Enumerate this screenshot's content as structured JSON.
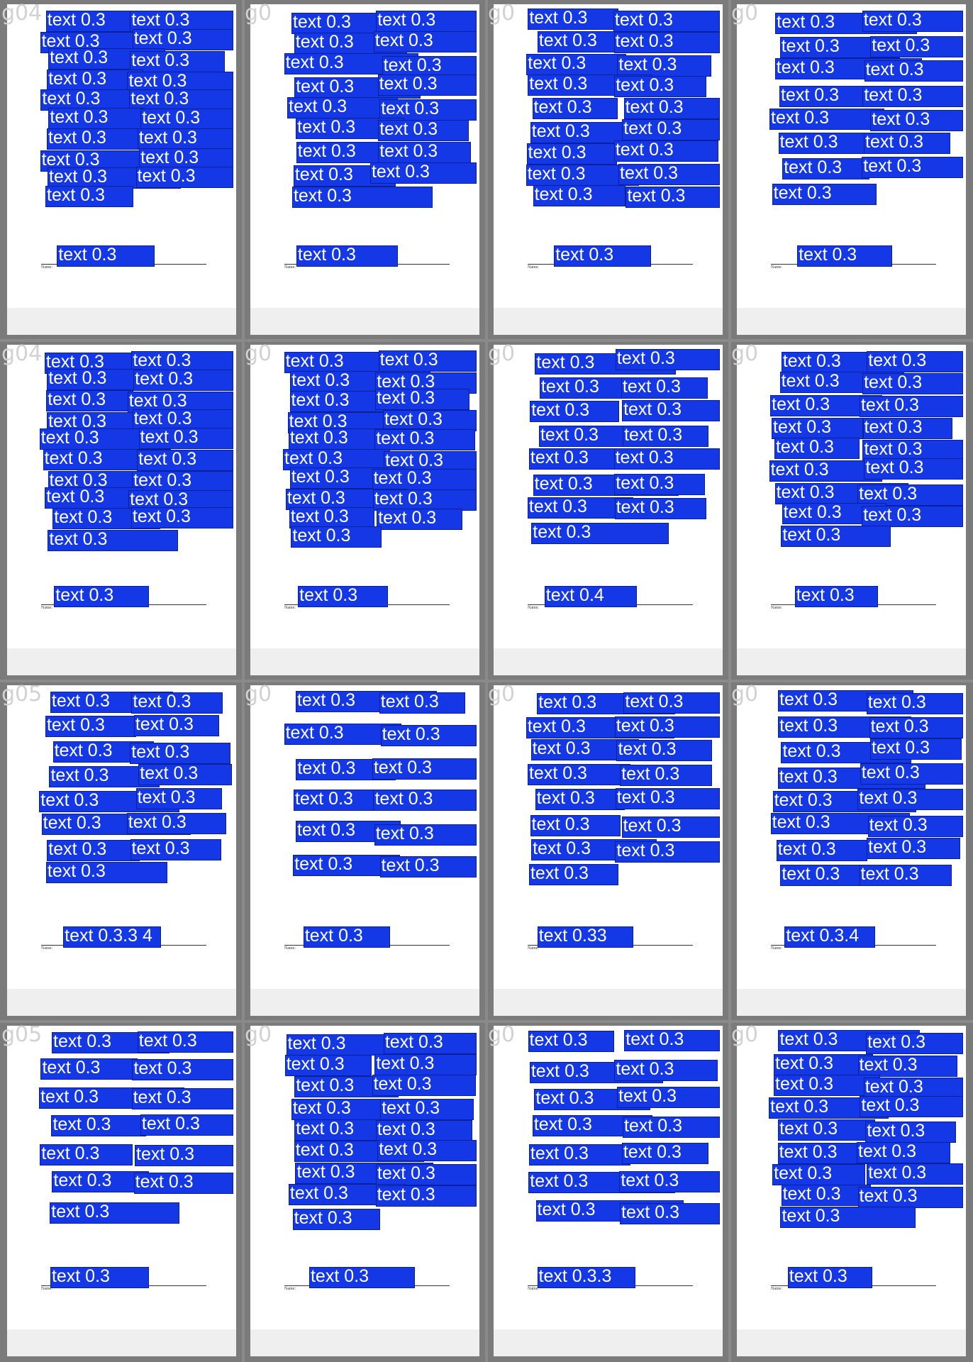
{
  "grid": {
    "tiles": [
      {
        "id": "g04",
        "name_label": "Name:",
        "boxes": [
          "text 0.3",
          "text 0.3",
          "text 0.3",
          "text 0.3",
          "text 0.3",
          "text 0.3",
          "text 0.3",
          "text 0.3",
          "text 0.3",
          "text 0.3",
          "text 0.3",
          "text 0.3",
          "text 0.3",
          "text 0.3",
          "text 0.3",
          "text 0.3",
          "text 0.3",
          "text 0.3",
          "text 0.3",
          "text 0.3"
        ]
      },
      {
        "id": "g0",
        "name_label": "Name:",
        "boxes": [
          "text 0.3",
          "text 0.3",
          "text 0.3",
          "text 0.3",
          "text 0.3",
          "text 0.3",
          "text 0.3",
          "text 0.3",
          "text 0.3",
          "text 0.3",
          "text 0.3",
          "text 0.3",
          "text 0.3",
          "text 0.3",
          "text 0.3",
          "text 0.3",
          "text 0.3",
          "text 0.3"
        ]
      },
      {
        "id": "g0",
        "name_label": "Name:",
        "boxes": [
          "text 0.3",
          "text 0.3",
          "text 0.3",
          "text 0.3",
          "text 0.3",
          "text 0.3",
          "text 0.3",
          "text 0.3",
          "text 0.3",
          "text 0.3",
          "text 0.3",
          "text 0.3",
          "text 0.3",
          "text 0.3",
          "text 0.3",
          "text 0.3",
          "text 0.3",
          "text 0.3",
          "text 0.3"
        ]
      },
      {
        "id": "g0",
        "name_label": "Name:",
        "boxes": [
          "text 0.3",
          "text 0.3",
          "text 0.3",
          "text 0.3",
          "text 0.3",
          "text 0.3",
          "text 0.3",
          "text 0.3",
          "text 0.3",
          "text 0.3",
          "text 0.3",
          "text 0.3",
          "text 0.3",
          "text 0.3",
          "text 0.3",
          "text 0.3"
        ]
      },
      {
        "id": "g04",
        "name_label": "Name:",
        "boxes": [
          "text 0.3",
          "text 0.3",
          "text 0.3",
          "text 0.3",
          "text 0.3",
          "text 0.3",
          "text 0.3",
          "text 0.3",
          "text 0.3",
          "text 0.3",
          "text 0.3",
          "text 0.3",
          "text 0.3",
          "text 0.3",
          "text 0.3",
          "text 0.3",
          "text 0.3",
          "text 0.3",
          "text 0.3",
          "text 0.3"
        ]
      },
      {
        "id": "g0",
        "name_label": "Name:",
        "boxes": [
          "text 0.3",
          "text 0.3",
          "text 0.3",
          "text 0.3",
          "text 0.3",
          "text 0.3",
          "text 0.3",
          "text 0.3",
          "text 0.3",
          "text 0.3",
          "text 0.3",
          "text 0.3",
          "text 0.3",
          "text 0.3",
          "text 0.3",
          "text 0.3",
          "text 0.3",
          "text 0.3",
          "text 0.3",
          "text 0.3"
        ]
      },
      {
        "id": "g0",
        "name_label": "Name:",
        "boxes": [
          "text 0.3",
          "text 0.3",
          "text 0.3",
          "text 0.3",
          "text 0.3",
          "text 0.3",
          "text 0.3",
          "text 0.3",
          "text 0.3",
          "text 0.3",
          "text 0.3",
          "text 0.3",
          "text 0.3",
          "text 0.3",
          "text 0.3",
          "text 0.4"
        ]
      },
      {
        "id": "g0",
        "name_label": "Name:",
        "boxes": [
          "text 0.3",
          "text 0.3",
          "text 0.3",
          "text 0.3",
          "text 0.3",
          "text 0.3",
          "text 0.3",
          "text 0.3",
          "text 0.3",
          "text 0.3",
          "text 0.3",
          "text 0.3",
          "text 0.3",
          "text 0.3",
          "text 0.3",
          "text 0.3",
          "text 0.3",
          "text 0.3"
        ]
      },
      {
        "id": "g05",
        "name_label": "Name:",
        "boxes": [
          "text 0.3",
          "text 0.3",
          "text 0.3",
          "text 0.3",
          "text 0.3",
          "text 0.3",
          "text 0.3",
          "text 0.3",
          "text 0.3",
          "text 0.3",
          "text 0.3",
          "text 0.3",
          "text 0.3",
          "text 0.3",
          "text 0.3",
          "text 0.3.3 4"
        ]
      },
      {
        "id": "g0",
        "name_label": "Name:",
        "boxes": [
          "text 0.3",
          "text 0.3",
          "text 0.3",
          "text 0.3",
          "text 0.3",
          "text 0.3",
          "text 0.3",
          "text 0.3",
          "text 0.3",
          "text 0.3",
          "text 0.3",
          "text 0.3",
          "text 0.3"
        ]
      },
      {
        "id": "g0",
        "name_label": "Name:",
        "boxes": [
          "text 0.3",
          "text 0.3",
          "text 0.3",
          "text 0.3",
          "text 0.3",
          "text 0.3",
          "text 0.3",
          "text 0.3",
          "text 0.3",
          "text 0.3",
          "text 0.3",
          "text 0.3",
          "text 0.3",
          "text 0.3",
          "text 0.3",
          "text 0.33"
        ]
      },
      {
        "id": "g0",
        "name_label": "Name:",
        "boxes": [
          "text 0.3",
          "text 0.3",
          "text 0.3",
          "text 0.3",
          "text 0.3",
          "text 0.3",
          "text 0.3",
          "text 0.3",
          "text 0.3",
          "text 0.3",
          "text 0.3",
          "text 0.3",
          "text 0.3",
          "text 0.3",
          "text 0.3",
          "text 0.3",
          "text 0.3.4"
        ]
      },
      {
        "id": "g05",
        "name_label": "Name:",
        "boxes": [
          "text 0.3",
          "text 0.3",
          "text 0.3",
          "text 0.3",
          "text 0.3",
          "text 0.3",
          "text 0.3",
          "text 0.3",
          "text 0.3",
          "text 0.3",
          "text 0.3",
          "text 0.3",
          "text 0.3",
          "text 0.3"
        ]
      },
      {
        "id": "g0",
        "name_label": "Name:",
        "boxes": [
          "text 0.3",
          "text 0.3",
          "text 0.3",
          "text 0.3",
          "text 0.3",
          "text 0.3",
          "text 0.3",
          "text 0.3",
          "text 0.3",
          "text 0.3",
          "text 0.3",
          "text 0.3",
          "text 0.3",
          "text 0.3",
          "text 0.3",
          "text 0.3",
          "text 0.3",
          "text 0.3"
        ]
      },
      {
        "id": "g0",
        "name_label": "Name:",
        "boxes": [
          "text 0.3",
          "text 0.3",
          "text 0.3",
          "text 0.3",
          "text 0.3",
          "text 0.3",
          "text 0.3",
          "text 0.3",
          "text 0.3",
          "text 0.3",
          "text 0.3",
          "text 0.3",
          "text 0.3",
          "text 0.3",
          "text 0.3.3"
        ]
      },
      {
        "id": "g0",
        "name_label": "Name:",
        "boxes": [
          "text 0.3",
          "text 0.3",
          "text 0.3",
          "text 0.3",
          "text 0.3",
          "text 0.3",
          "text 0.3",
          "text 0.3",
          "text 0.3",
          "text 0.3",
          "text 0.3",
          "text 0.3",
          "text 0.3",
          "text 0.3",
          "text 0.3",
          "text 0.3",
          "text 0.3",
          "text 0.3"
        ]
      }
    ],
    "colors": {
      "box": "#1538e6",
      "frame": "#7b7b7b",
      "paper": "#ffffff",
      "label": "#ffffff"
    }
  }
}
